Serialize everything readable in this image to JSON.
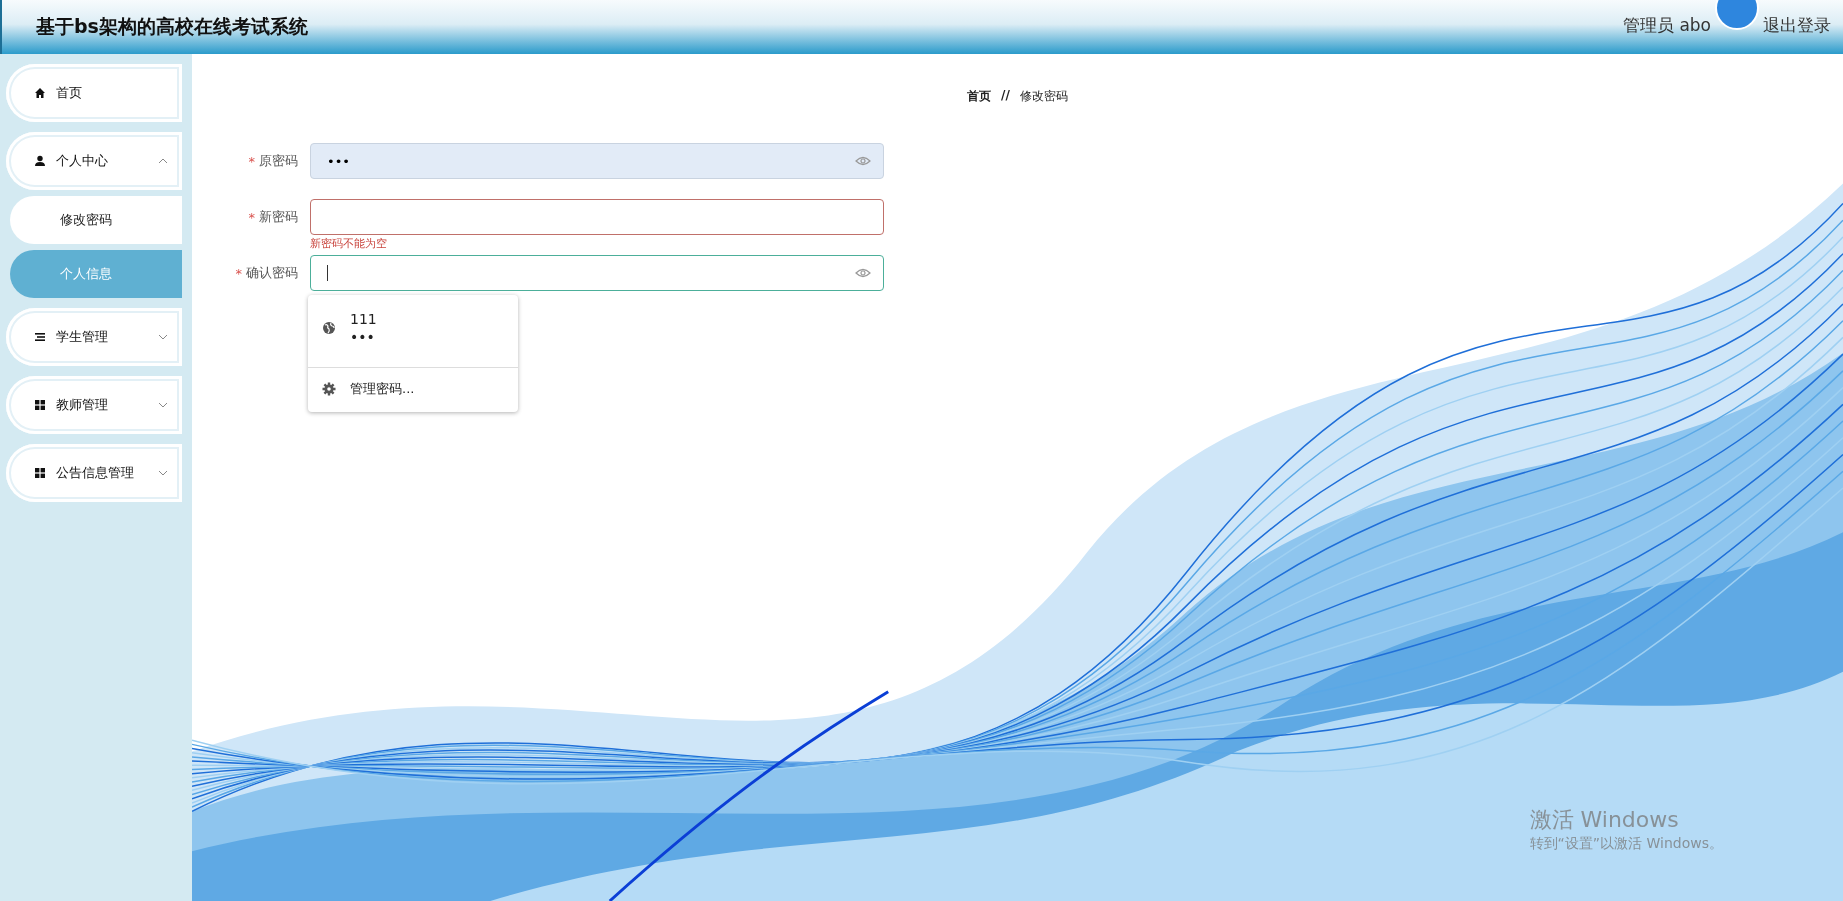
{
  "header": {
    "title": "基于bs架构的高校在线考试系统",
    "user": "管理员 abo",
    "logout": "退出登录"
  },
  "sidebar": {
    "items": [
      {
        "label": "首页",
        "kind": "home"
      },
      {
        "label": "个人中心",
        "kind": "user",
        "expanded": true,
        "children": [
          {
            "label": "修改密码",
            "selected": false
          },
          {
            "label": "个人信息",
            "selected": true
          }
        ]
      },
      {
        "label": "学生管理",
        "kind": "list",
        "expanded": false
      },
      {
        "label": "教师管理",
        "kind": "grid",
        "expanded": false
      },
      {
        "label": "公告信息管理",
        "kind": "grid",
        "expanded": false
      }
    ]
  },
  "breadcrumb": {
    "items": [
      "首页",
      "修改密码"
    ],
    "separator": "//"
  },
  "form": {
    "fields": [
      {
        "mark": "*",
        "label": "原密码",
        "value": "•••",
        "autofilled": true,
        "invalid": false,
        "focused": false,
        "show_toggle": true
      },
      {
        "mark": "*",
        "label": "新密码",
        "autofilled": false,
        "invalid": true,
        "focused": false,
        "show_toggle": false,
        "error": "新密码不能为空"
      },
      {
        "mark": "*",
        "label": "确认密码",
        "autofilled": false,
        "invalid": false,
        "focused": true,
        "show_toggle": true
      }
    ]
  },
  "autofill": {
    "entries": [
      {
        "username": "111",
        "password": "•••"
      }
    ],
    "manage": "管理密码..."
  },
  "windows_notice": {
    "title": "激活 Windows",
    "hint": "转到“设置”以激活 Windows。"
  }
}
